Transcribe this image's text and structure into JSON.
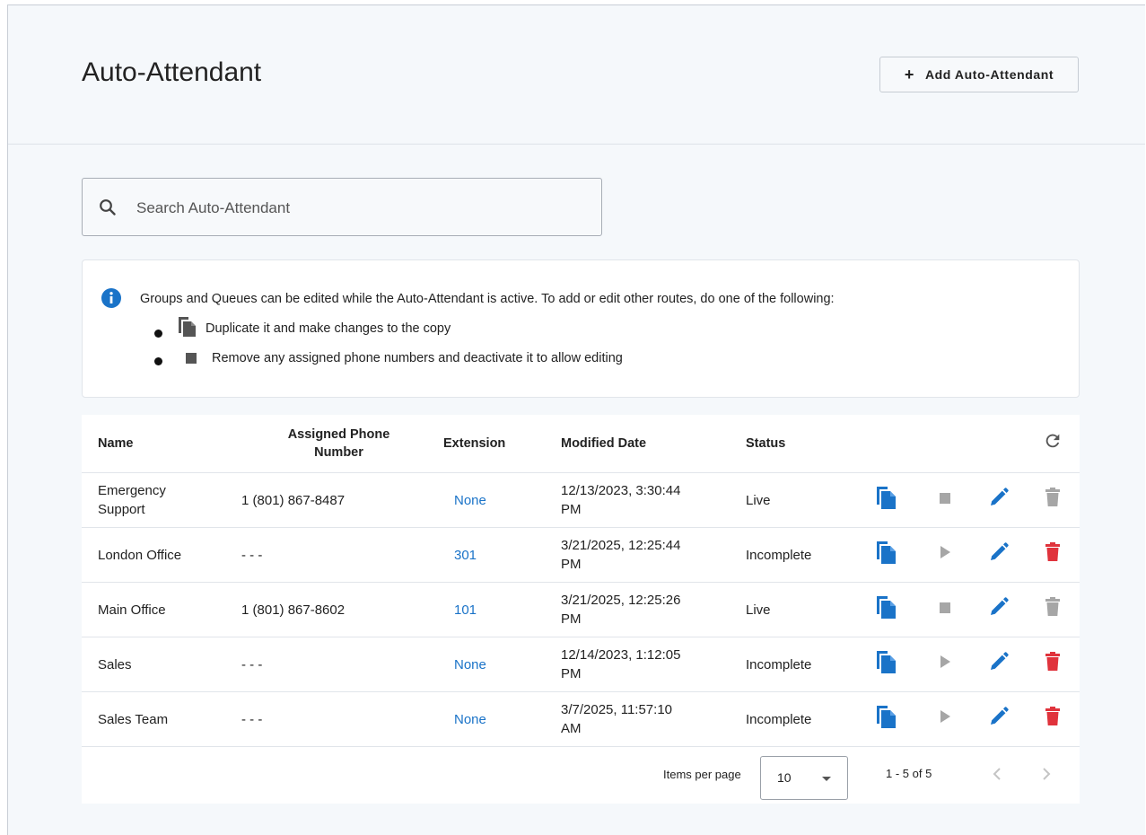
{
  "header": {
    "title": "Auto-Attendant",
    "add_button_label": "Add Auto-Attendant"
  },
  "search": {
    "placeholder": "Search Auto-Attendant",
    "value": ""
  },
  "info": {
    "message": "Groups and Queues can be edited while the Auto-Attendant is active. To add or edit other routes, do one of the following:",
    "bullets": [
      {
        "icon": "copy-icon",
        "text": "Duplicate it and make changes to the copy"
      },
      {
        "icon": "stop-icon",
        "text": "Remove any assigned phone numbers and deactivate it to allow editing"
      }
    ]
  },
  "table": {
    "columns": {
      "name": "Name",
      "phone_line1": "Assigned Phone",
      "phone_line2": "Number",
      "extension": "Extension",
      "modified_line1": "Modified Date",
      "status": "Status"
    },
    "rows": [
      {
        "name_line1": "Emergency",
        "name_line2": "Support",
        "phone": "1 (801) 867-8487",
        "extension": "None",
        "modified_line1": "12/13/2023, 3:30:44",
        "modified_line2": "PM",
        "status": "Live",
        "toggle": "stop",
        "deletable": false
      },
      {
        "name_line1": "London Office",
        "name_line2": "",
        "phone": "- - -",
        "extension": "301",
        "modified_line1": "3/21/2025, 12:25:44",
        "modified_line2": "PM",
        "status": "Incomplete",
        "toggle": "play",
        "deletable": true
      },
      {
        "name_line1": "Main Office",
        "name_line2": "",
        "phone": "1 (801) 867-8602",
        "extension": "101",
        "modified_line1": "3/21/2025, 12:25:26",
        "modified_line2": "PM",
        "status": "Live",
        "toggle": "stop",
        "deletable": false
      },
      {
        "name_line1": "Sales",
        "name_line2": "",
        "phone": "- - -",
        "extension": "None",
        "modified_line1": "12/14/2023, 1:12:05",
        "modified_line2": "PM",
        "status": "Incomplete",
        "toggle": "play",
        "deletable": true
      },
      {
        "name_line1": "Sales Team",
        "name_line2": "",
        "phone": "- - -",
        "extension": "None",
        "modified_line1": "3/7/2025, 11:57:10",
        "modified_line2": "AM",
        "status": "Incomplete",
        "toggle": "play",
        "deletable": true
      }
    ]
  },
  "pagination": {
    "items_per_page_label": "Items per page",
    "items_per_page_value": "10",
    "range_text": "1 - 5 of 5"
  },
  "colors": {
    "accent_blue": "#1a73c8",
    "delete_red": "#e0333c",
    "disabled_gray": "#a6a6a6",
    "background": "#f5f8fb"
  }
}
